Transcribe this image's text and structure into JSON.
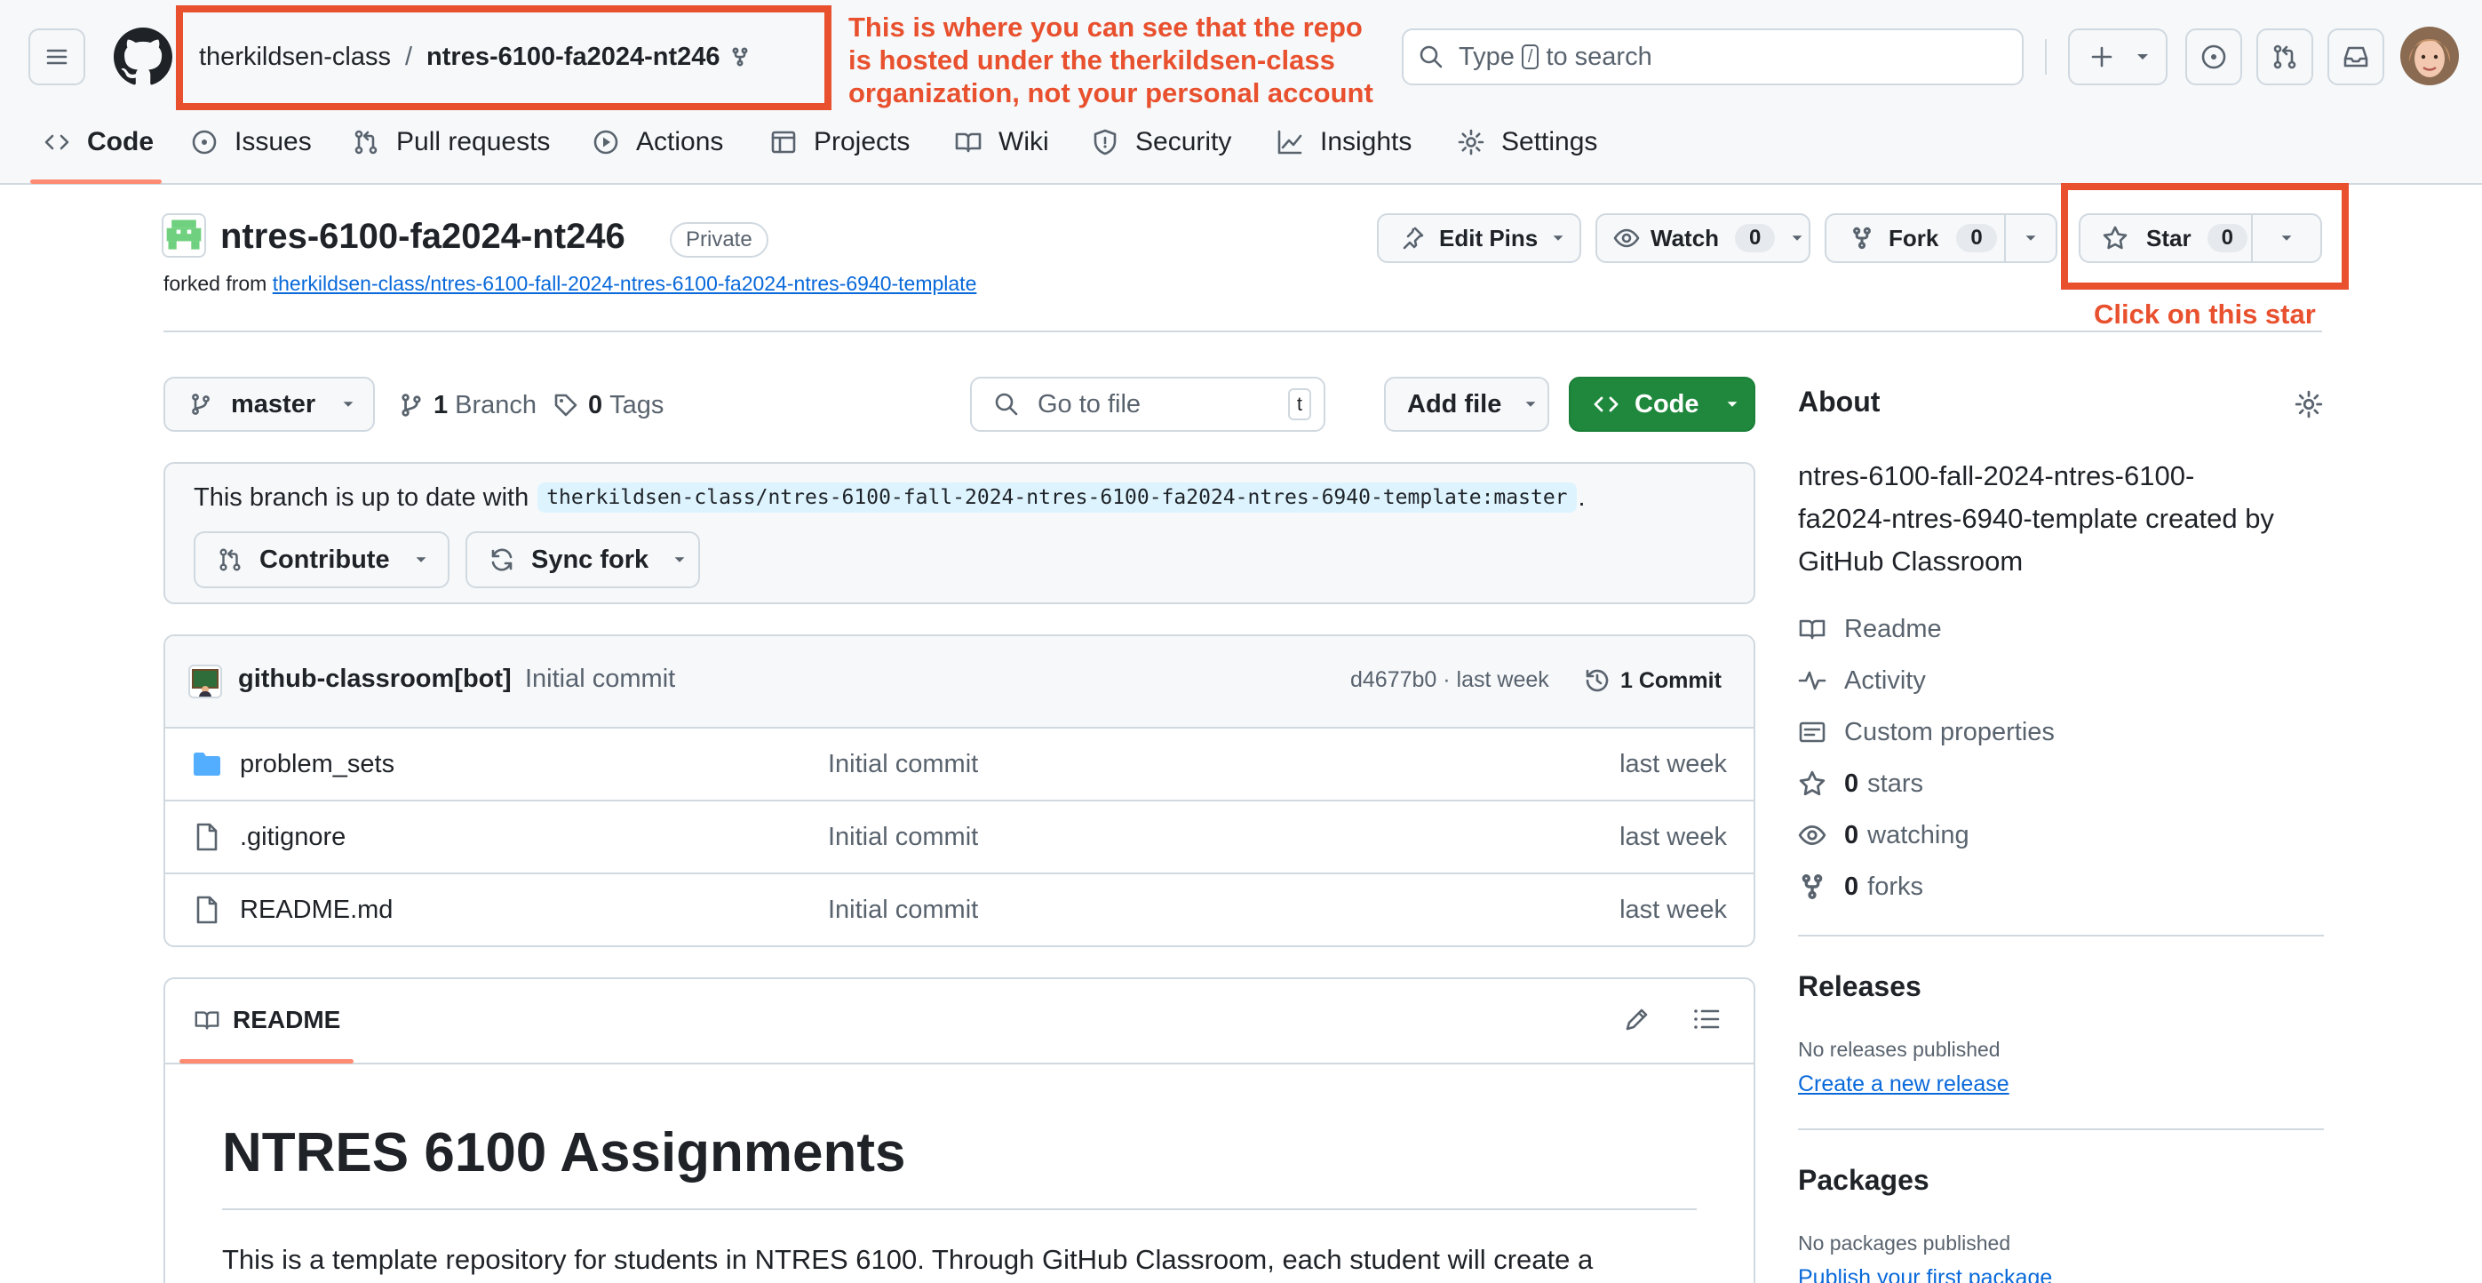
{
  "header": {
    "owner": "therkildsen-class",
    "separator": "/",
    "repo": "ntres-6100-fa2024-nt246",
    "search_prefix": "Type",
    "search_key": "/",
    "search_suffix": "to search",
    "plus": "+"
  },
  "annotations": {
    "repo_note_line1": "This is where you can see that the repo",
    "repo_note_line2": "is hosted under the therkildsen-class",
    "repo_note_line3": "organization, not your personal account",
    "star_note": "Click on this star"
  },
  "nav": {
    "code": "Code",
    "issues": "Issues",
    "pull_requests": "Pull requests",
    "actions": "Actions",
    "projects": "Projects",
    "wiki": "Wiki",
    "security": "Security",
    "insights": "Insights",
    "settings": "Settings"
  },
  "repo": {
    "name": "ntres-6100-fa2024-nt246",
    "visibility": "Private",
    "forked_from_label": "forked from",
    "forked_from_link": "therkildsen-class/ntres-6100-fall-2024-ntres-6100-fa2024-ntres-6940-template",
    "edit_pins": "Edit Pins",
    "watch": "Watch",
    "watch_count": "0",
    "fork": "Fork",
    "fork_count": "0",
    "star": "Star",
    "star_count": "0"
  },
  "toolbar": {
    "branch": "master",
    "branch_count": "1",
    "branch_label": "Branch",
    "tag_count": "0",
    "tag_label": "Tags",
    "goto_placeholder": "Go to file",
    "goto_key": "t",
    "add_file": "Add file",
    "code": "Code"
  },
  "branch_box": {
    "text": "This branch is up to date with",
    "ref": "therkildsen-class/ntres-6100-fall-2024-ntres-6100-fa2024-ntres-6940-template:master",
    "period": ".",
    "contribute": "Contribute",
    "sync_fork": "Sync fork"
  },
  "commit": {
    "author": "github-classroom[bot]",
    "message": "Initial commit",
    "sha_time": "d4677b0 · last week",
    "count": "1 Commit"
  },
  "files": [
    {
      "name": "problem_sets",
      "type": "folder",
      "message": "Initial commit",
      "time": "last week"
    },
    {
      "name": ".gitignore",
      "type": "file",
      "message": "Initial commit",
      "time": "last week"
    },
    {
      "name": "README.md",
      "type": "file",
      "message": "Initial commit",
      "time": "last week"
    }
  ],
  "readme": {
    "tab": "README",
    "heading": "NTRES 6100 Assignments",
    "body": "This is a template repository for students in NTRES 6100. Through GitHub Classroom, each student will create a"
  },
  "about": {
    "title": "About",
    "description_line1": "ntres-6100-fall-2024-ntres-6100-",
    "description_line2": "fa2024-ntres-6940-template created by",
    "description_line3": "GitHub Classroom",
    "readme": "Readme",
    "activity": "Activity",
    "custom_properties": "Custom properties",
    "stars_count": "0",
    "stars_label": "stars",
    "watching_count": "0",
    "watching_label": "watching",
    "forks_count": "0",
    "forks_label": "forks"
  },
  "releases": {
    "title": "Releases",
    "none": "No releases published",
    "link": "Create a new release"
  },
  "packages": {
    "title": "Packages",
    "none": "No packages published",
    "link": "Publish your first package"
  },
  "colors": {
    "annotation": "#e8502e",
    "primary_button": "#1f883d",
    "link": "#0969da",
    "nav_underline": "#fd8c73",
    "folder": "#54aeff"
  }
}
